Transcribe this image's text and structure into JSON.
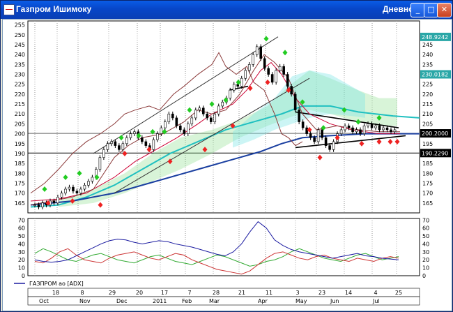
{
  "window": {
    "title": "Газпром Ишимоку",
    "timeframe": "Дневной",
    "buttons": {
      "minimize": "_",
      "maximize": "□",
      "close": "✕"
    }
  },
  "price_axis": {
    "ticks": [
      "255",
      "250",
      "245",
      "240",
      "235",
      "230",
      "225",
      "220",
      "215",
      "210",
      "205",
      "200",
      "195",
      "190",
      "185",
      "180",
      "175",
      "170",
      "165"
    ],
    "right_ticks": [
      "250",
      "245",
      "240",
      "235",
      "230",
      "225",
      "220",
      "215",
      "210",
      "205",
      "200",
      "195",
      "190",
      "185",
      "180",
      "175",
      "170",
      "165"
    ],
    "badges": [
      {
        "label": "248.9242",
        "color": "#2aa7a7"
      },
      {
        "label": "230.0182",
        "color": "#2aa7a7"
      },
      {
        "label": "200.2000",
        "color": "#000000"
      },
      {
        "label": "190.2290",
        "color": "#000000"
      }
    ]
  },
  "indicator_axis": {
    "ticks": [
      "70",
      "60",
      "50",
      "40",
      "30",
      "20",
      "10",
      "0"
    ]
  },
  "legend": {
    "label": "ГАЗПРОМ ао [ADX]",
    "color": "#1a1aa0"
  },
  "time_axis": {
    "days": [
      "18",
      "8",
      "29",
      "20",
      "17",
      "7",
      "28",
      "21",
      "11",
      "3",
      "23",
      "14",
      "4",
      "25"
    ],
    "months": [
      "Oct",
      "Nov",
      "Dec",
      "2011",
      "Feb",
      "Mar",
      "Apr",
      "May",
      "Jun",
      "Jul"
    ]
  },
  "chart_data": {
    "type": "line",
    "series": [
      {
        "name": "ГАЗПРОМ ао [ADX]",
        "color": "#1a1aa0"
      }
    ],
    "price_ylim": [
      160,
      257
    ],
    "indicator_ylim": [
      0,
      72
    ],
    "reference_lines": [
      190.229,
      200.2
    ],
    "colors": {
      "price": "#000000",
      "kijun": "#cc0033",
      "tenkan": "#8b3a3a",
      "chikou": "#8b3a3a",
      "senkou_a": "#20c0c0",
      "senkou_b": "#1a3fa0",
      "cloud": "#22bb22",
      "signal_up": "#22cc22",
      "signal_down": "#ee2222"
    }
  }
}
